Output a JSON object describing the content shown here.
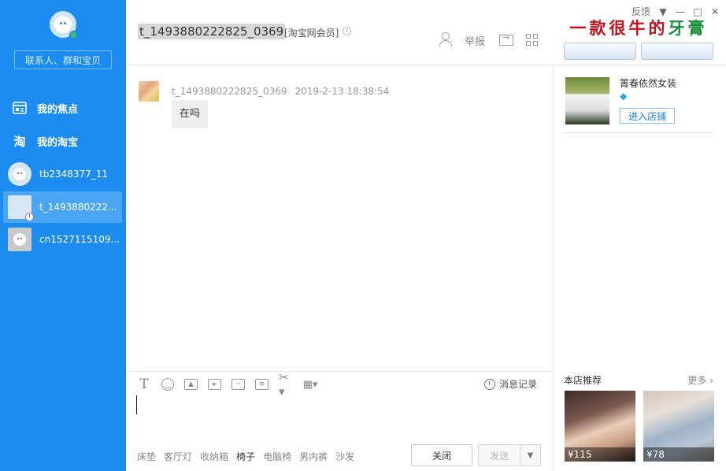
{
  "sidebar": {
    "search_placeholder": "联系人、群和宝贝",
    "nav": [
      {
        "label": "我的焦点",
        "icon": "focus-icon"
      },
      {
        "label": "我的淘宝",
        "icon": "taobao-icon",
        "glyph": "淘"
      }
    ],
    "contacts": [
      {
        "name": "tb2348377_11",
        "active": false
      },
      {
        "name": "t_1493880222...",
        "active": true
      },
      {
        "name": "cn1527115109...",
        "active": false
      }
    ]
  },
  "header": {
    "title": "t_1493880222825_0369",
    "member_tag": "[淘宝网会员]",
    "report_label": "举报",
    "feedback_label": "反馈",
    "ad": {
      "line_red": "一款很牛的",
      "line_green": "牙膏"
    }
  },
  "chat": {
    "messages": [
      {
        "sender": "t_1493880222825_0369",
        "time": "2019-2-13 18:38:54",
        "text": "在吗"
      }
    ]
  },
  "input": {
    "history_label": "消息记录",
    "tags": [
      "床垫",
      "客厅灯",
      "收纳箱",
      "椅子",
      "电脑椅",
      "男内裤",
      "沙发"
    ],
    "selected_tag_index": 3,
    "close_label": "关闭",
    "send_label": "发送"
  },
  "shop": {
    "name": "箐春依然女装",
    "enter_label": "进入店铺",
    "recommend_title": "本店推荐",
    "more_label": "更多",
    "products": [
      {
        "price": "¥115"
      },
      {
        "price": "¥78"
      }
    ]
  },
  "colors": {
    "sidebar_bg": "#1c8cf0",
    "active_contact_bg": "#4aa6f5",
    "ad_red": "#c4121b",
    "ad_green": "#1a8f3b"
  }
}
